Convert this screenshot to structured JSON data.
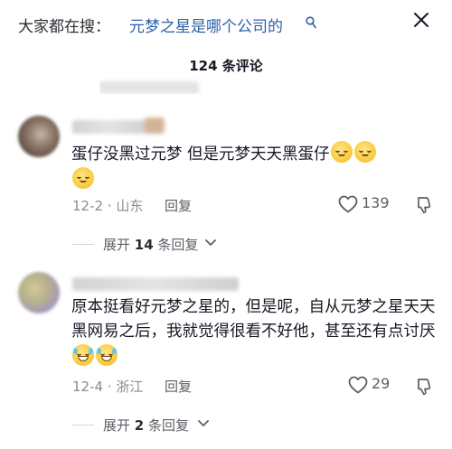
{
  "search": {
    "prefix": "大家都在搜：",
    "query": "元梦之星是哪个公司的"
  },
  "comments_header": {
    "count_label": "124 条评论"
  },
  "comments": [
    {
      "text": "蛋仔没黑过元梦  但是元梦天天黑蛋仔",
      "emoji_count": 3,
      "date_location": "12-2 · 山东",
      "reply_label": "回复",
      "likes": "139",
      "expand_prefix": "展开 ",
      "expand_count": "14",
      "expand_suffix": " 条回复"
    },
    {
      "text": "原本挺看好元梦之星的，但是呢，自从元梦之星天天黑网易之后，我就觉得很看不好他，甚至还有点讨厌",
      "emoji_count": 2,
      "date_location": "12-4 · 浙江",
      "reply_label": "回复",
      "likes": "29",
      "expand_prefix": "展开 ",
      "expand_count": "2",
      "expand_suffix": " 条回复"
    }
  ],
  "colors": {
    "link_blue": "#2d5fa8",
    "meta_gray": "#8a8b91",
    "text_dark": "#161823"
  },
  "icons": {
    "search": "search-icon",
    "close": "close-icon",
    "like": "heart-icon",
    "dislike": "thumbs-down-icon",
    "expand": "chevron-down-icon"
  }
}
